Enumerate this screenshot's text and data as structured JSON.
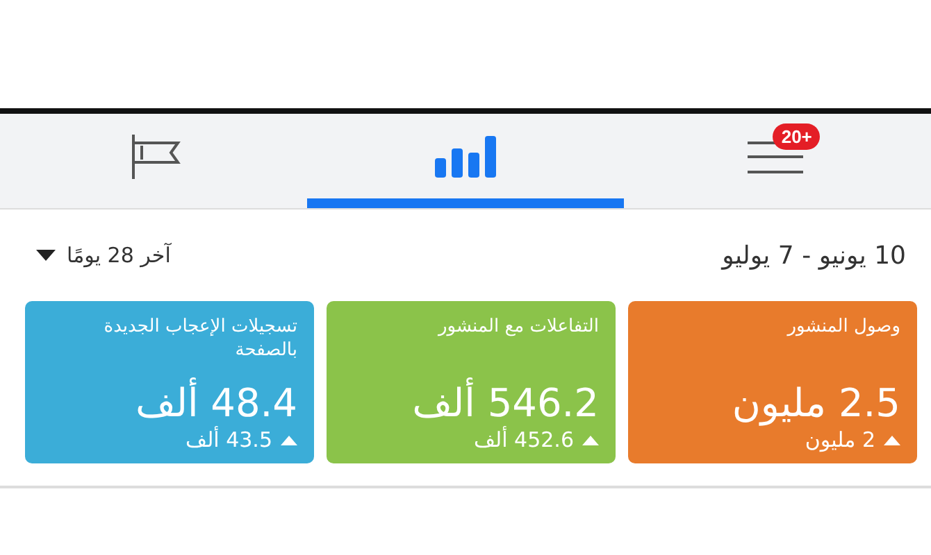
{
  "tabs": [
    {
      "kind": "menu",
      "badge": "20+",
      "selected": false
    },
    {
      "kind": "chart",
      "selected": true
    },
    {
      "kind": "flag",
      "selected": false
    }
  ],
  "date_range": "10 يونيو - 7 يوليو",
  "period_picker": {
    "label": "آخر 28 يومًا"
  },
  "cards": [
    {
      "title": "وصول المنشور",
      "value": "2.5 مليون",
      "change": "2 مليون",
      "color": "#e87b2c"
    },
    {
      "title": "التفاعلات مع المنشور",
      "value": "546.2 ألف",
      "change": "452.6 ألف",
      "color": "#8bc34a"
    },
    {
      "title": "تسجيلات الإعجاب الجديدة بالصفحة",
      "value": "48.4 ألف",
      "change": "43.5 ألف",
      "color": "#3badd8"
    }
  ]
}
